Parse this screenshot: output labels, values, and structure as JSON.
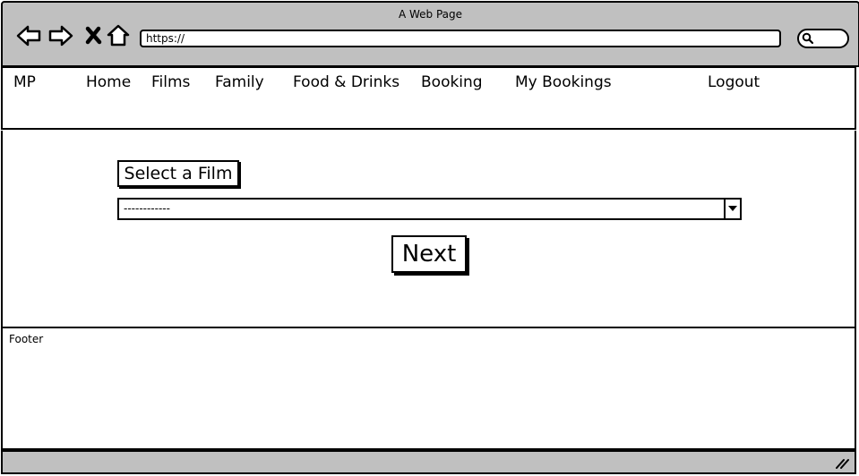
{
  "browser": {
    "title": "A Web Page",
    "url": "https://",
    "icons": {
      "back": "back-arrow-icon",
      "forward": "forward-arrow-icon",
      "stop": "close-icon",
      "home": "home-icon",
      "search": "search-icon"
    }
  },
  "navbar": {
    "brand": "MP",
    "items": [
      "Home",
      "Films",
      "Family",
      "Food & Drinks",
      "Booking",
      "My Bookings"
    ],
    "logout": "Logout"
  },
  "main": {
    "heading": "Select a Film",
    "select_value": "------------",
    "next_label": "Next"
  },
  "footer": {
    "label": "Footer"
  }
}
